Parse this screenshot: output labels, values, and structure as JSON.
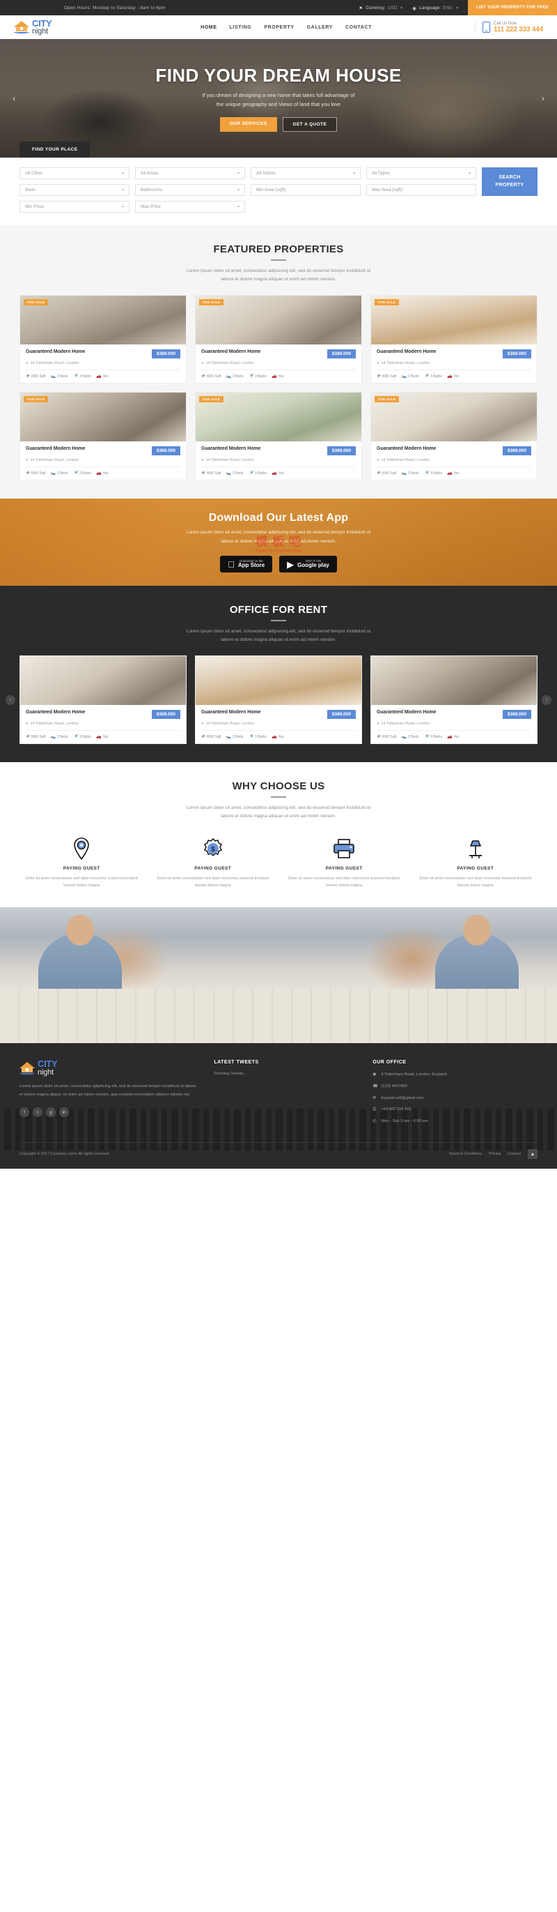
{
  "topbar": {
    "hours": "Open Hours: Monday to Saturday - 8am to 6pm",
    "currency_label": "Currency:",
    "currency_value": "USD",
    "language_label": "Language:",
    "language_value": "ENG",
    "cta": "LIST YOUR PROPERTY FOR FREE"
  },
  "header": {
    "logo_primary": "CITY",
    "logo_secondary": "night",
    "nav": [
      {
        "label": "HOME"
      },
      {
        "label": "LISTING"
      },
      {
        "label": "PROPERTY"
      },
      {
        "label": "GALLERY"
      },
      {
        "label": "CONTACT"
      }
    ],
    "call_label": "Call Us Now",
    "call_number": "111 222 333 444"
  },
  "hero": {
    "title": "FIND YOUR DREAM HOUSE",
    "subtitle_line1": "If you dream of designing a new home that takes full advantage of",
    "subtitle_line2": "the unique geography and Views of land that you love",
    "btn_primary": "OUR SERVICES",
    "btn_secondary": "GET A QUOTE",
    "tab_label": "FIND YOUR PLACE",
    "prev": "‹",
    "next": "›"
  },
  "search": {
    "fields": [
      {
        "label": "All Cities",
        "type": "select"
      },
      {
        "label": "All Areas",
        "type": "select"
      },
      {
        "label": "All Status",
        "type": "select"
      },
      {
        "label": "All Types",
        "type": "select"
      },
      {
        "label": "Beds",
        "type": "select"
      },
      {
        "label": "Bathrooms",
        "type": "select"
      },
      {
        "label": "Min Area (sqft)",
        "type": "text"
      },
      {
        "label": "Max Area (sqft)",
        "type": "text"
      },
      {
        "label": "Min Price",
        "type": "select"
      },
      {
        "label": "Max Price",
        "type": "select"
      }
    ],
    "button_line1": "SEARCH",
    "button_line2": "PROPERTY"
  },
  "featured": {
    "title": "FEATURED PROPERTIES",
    "desc_line1": "Lorem ipsum dolor sit amet, consectetur adipiscing elit, sed do eiusmod tempor incididunt ut",
    "desc_line2": "labore et dolore magna aliquan ut enim ad minim veniam.",
    "cards": [
      {
        "badge": "FOR SALE",
        "title": "Guaranteed Modern Home",
        "price": "$389.000",
        "address": "14 Tottenham Road, London",
        "sqft": "3060 Sqft",
        "beds": "3 Beds",
        "baths": "3 Baths",
        "garage": "Yes"
      },
      {
        "badge": "FOR SALE",
        "title": "Guaranteed Modern Home",
        "price": "$389.000",
        "address": "14 Tottenham Road, London",
        "sqft": "3060 Sqft",
        "beds": "3 Beds",
        "baths": "3 Baths",
        "garage": "Yes"
      },
      {
        "badge": "FOR SALE",
        "title": "Guaranteed Modern Home",
        "price": "$389.000",
        "address": "14 Tottenham Road, London",
        "sqft": "3060 Sqft",
        "beds": "3 Beds",
        "baths": "3 Baths",
        "garage": "Yes"
      },
      {
        "badge": "FOR SALE",
        "title": "Guaranteed Modern Home",
        "price": "$389.000",
        "address": "14 Tottenham Road, London",
        "sqft": "3060 Sqft",
        "beds": "3 Beds",
        "baths": "3 Baths",
        "garage": "Yes"
      },
      {
        "badge": "FOR SALE",
        "title": "Guaranteed Modern Home",
        "price": "$389.000",
        "address": "14 Tottenham Road, London",
        "sqft": "3060 Sqft",
        "beds": "3 Beds",
        "baths": "3 Baths",
        "garage": "Yes"
      },
      {
        "badge": "FOR SALE",
        "title": "Guaranteed Modern Home",
        "price": "$389.000",
        "address": "14 Tottenham Road, London",
        "sqft": "3060 Sqft",
        "beds": "3 Beds",
        "baths": "3 Baths",
        "garage": "Yes"
      }
    ]
  },
  "app": {
    "title": "Download Our Latest App",
    "desc_line1": "Lorem ipsum dolor sit amet, consectetur adipiscing elit, sed do eiusmod tempor incididunt ut",
    "desc_line2": "labore et dolore magna aliquan ut enim ad minim veniam.",
    "appstore_small": "Download on the",
    "appstore_big": "App Store",
    "googleplay_small": "GET IT ON",
    "googleplay_big": "Google play",
    "watermark_line1": "模 板 吧",
    "watermark_line2": "www.cssmoban.com"
  },
  "office": {
    "title": "OFFICE FOR RENT",
    "desc_line1": "Lorem ipsum dolor sit amet, consectetur adipiscing elit, sed do eiusmod tempor incididunt ut",
    "desc_line2": "labore et dolore magna aliquan ut enim ad minim veniam.",
    "prev": "‹",
    "next": "›",
    "cards": [
      {
        "title": "Guaranteed Modern Home",
        "price": "$389.000",
        "address": "14 Tottenham Road, London",
        "sqft": "3060 Sqft",
        "beds": "3 Beds",
        "baths": "3 Baths",
        "garage": "Yes"
      },
      {
        "title": "Guaranteed Modern Home",
        "price": "$389.000",
        "address": "14 Tottenham Road, London",
        "sqft": "3060 Sqft",
        "beds": "3 Beds",
        "baths": "3 Baths",
        "garage": "Yes"
      },
      {
        "title": "Guaranteed Modern Home",
        "price": "$389.000",
        "address": "14 Tottenham Road, London",
        "sqft": "3060 Sqft",
        "beds": "3 Beds",
        "baths": "3 Baths",
        "garage": "Yes"
      }
    ]
  },
  "why": {
    "title": "WHY CHOOSE US",
    "desc_line1": "Lorem ipsum dolor sit amet, consectetur adipiscing elit, sed do eiusmod tempor incididunt ut",
    "desc_line2": "labore et dolore magna aliquan ut enim ad minim veniam.",
    "items": [
      {
        "icon": "location-gear-icon",
        "title": "PAYING GUEST",
        "desc": "Dolor sit amet consectetuer sed diam nonummy euismod tincidunt laoreet dolore magna"
      },
      {
        "icon": "dollar-badge-icon",
        "title": "PAYING GUEST",
        "desc": "Dolor sit amet consectetuer sed diam nonummy euismod tincidunt laoreet dolore magna"
      },
      {
        "icon": "printer-icon",
        "title": "PAYING GUEST",
        "desc": "Dolor sit amet consectetuer sed diam nonummy euismod tincidunt laoreet dolore magna"
      },
      {
        "icon": "desk-lamp-icon",
        "title": "PAYING GUEST",
        "desc": "Dolor sit amet consectetuer sed diam nonummy euismod tincidunt laoreet dolore magna"
      }
    ]
  },
  "footer": {
    "logo_primary": "CITY",
    "logo_secondary": "night",
    "about": "Lorem ipsum dolor sit amet, consectetur adipiscing elit, sed do eiusmod tempor incididunt ut labore et dolore magna aliqua. Ut enim ad minim veniam, quis nostrud exercitation ullamco laboris nisi",
    "socials": [
      {
        "name": "facebook-icon",
        "glyph": "f"
      },
      {
        "name": "twitter-icon",
        "glyph": "t"
      },
      {
        "name": "google-plus-icon",
        "glyph": "g"
      },
      {
        "name": "linkedin-icon",
        "glyph": "in"
      }
    ],
    "tweets_title": "LATEST TWEETS",
    "tweets_body": "Fetching Tweets...",
    "office_title": "OUR OFFICE",
    "contacts": [
      {
        "icon": "map-pin-icon",
        "glyph": "◉",
        "text": "4 Tottenham Road, London, England"
      },
      {
        "icon": "phone-icon",
        "glyph": "☎",
        "text": "(123) 4567880"
      },
      {
        "icon": "envelope-icon",
        "glyph": "✉",
        "text": "buyand.sell@gmail.com"
      },
      {
        "icon": "fax-icon",
        "glyph": "⎙",
        "text": "+64 662 216 601"
      },
      {
        "icon": "clock-icon",
        "glyph": "◴",
        "text": "Mon - Sat: 9 am - 6:00 pm"
      }
    ],
    "copyright": "Copyright © 2017 Company name All rights reserved.",
    "links": [
      {
        "label": "Terms & Conditions"
      },
      {
        "label": "Pricing"
      },
      {
        "label": "Contact"
      }
    ],
    "to_top": "▲"
  },
  "colors": {
    "accent_orange": "#f0a03c",
    "accent_blue": "#5b8ad6",
    "dark": "#2b2b2b",
    "logo_blue": "#4a7fd4"
  }
}
